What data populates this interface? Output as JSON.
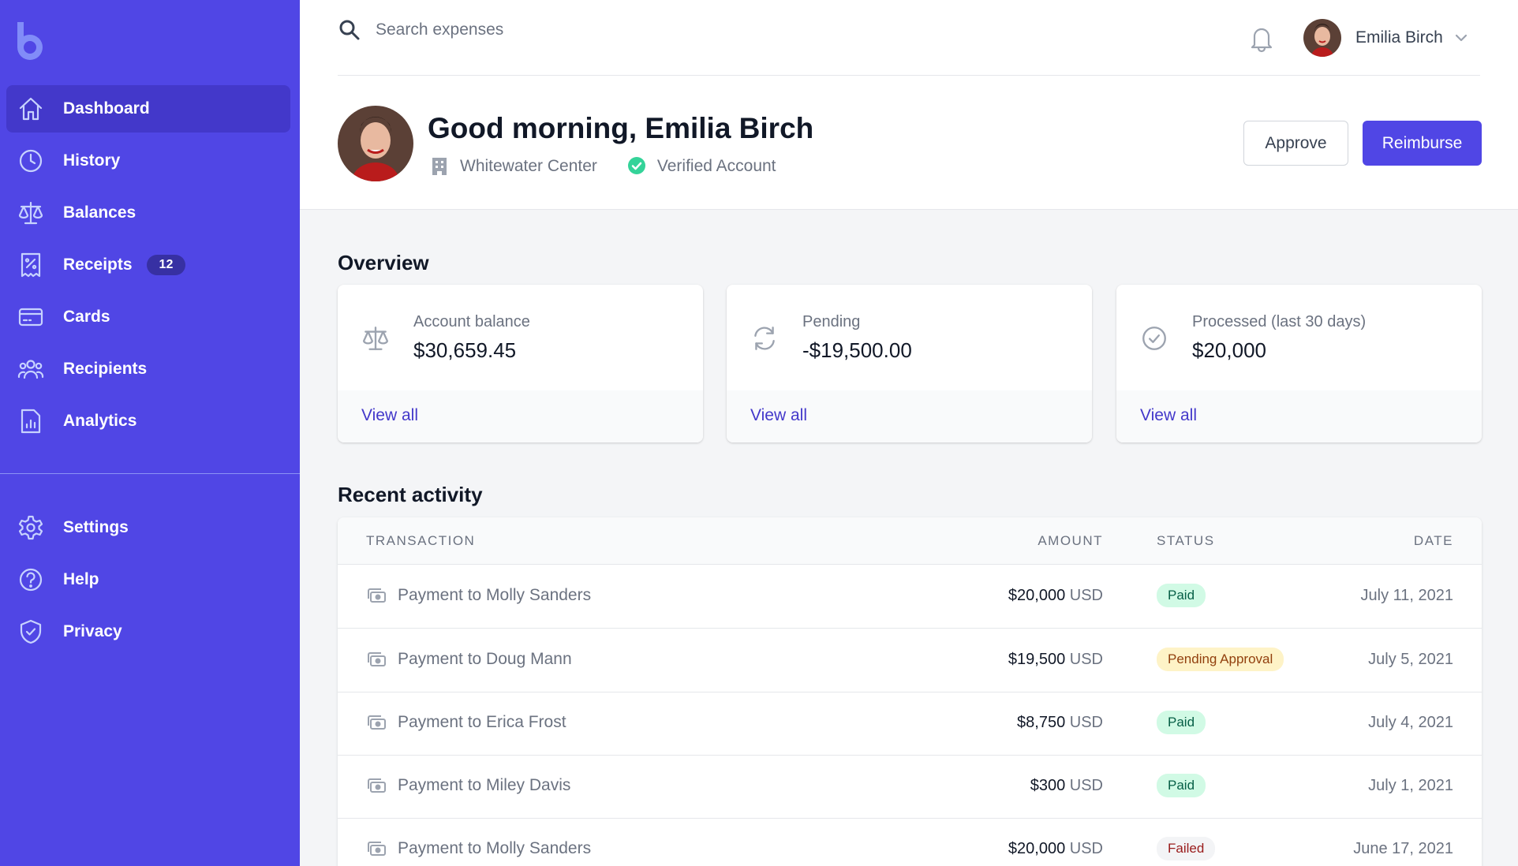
{
  "sidebar": {
    "nav": [
      {
        "label": "Dashboard",
        "icon": "home-icon"
      },
      {
        "label": "History",
        "icon": "clock-icon"
      },
      {
        "label": "Balances",
        "icon": "scale-icon"
      },
      {
        "label": "Receipts",
        "icon": "receipt-icon",
        "badge": "12"
      },
      {
        "label": "Cards",
        "icon": "credit-card-icon"
      },
      {
        "label": "Recipients",
        "icon": "users-icon"
      },
      {
        "label": "Analytics",
        "icon": "chart-icon"
      }
    ],
    "secondary": [
      {
        "label": "Settings",
        "icon": "gear-icon"
      },
      {
        "label": "Help",
        "icon": "question-icon"
      },
      {
        "label": "Privacy",
        "icon": "shield-icon"
      }
    ],
    "active": "Dashboard"
  },
  "search": {
    "placeholder": "Search expenses",
    "value": ""
  },
  "user": {
    "name": "Emilia Birch"
  },
  "header": {
    "greeting": "Good morning, Emilia Birch",
    "location": "Whitewater Center",
    "verified": "Verified Account",
    "approve_label": "Approve",
    "reimburse_label": "Reimburse"
  },
  "overview": {
    "title": "Overview",
    "cards": [
      {
        "label": "Account balance",
        "value": "$30,659.45",
        "link": "View all",
        "icon": "scale-icon"
      },
      {
        "label": "Pending",
        "value": "-$19,500.00",
        "link": "View all",
        "icon": "refresh-icon"
      },
      {
        "label": "Processed (last 30 days)",
        "value": "$20,000",
        "link": "View all",
        "icon": "check-circle-icon"
      }
    ]
  },
  "activity": {
    "title": "Recent activity",
    "columns": {
      "transaction": "TRANSACTION",
      "amount": "AMOUNT",
      "status": "STATUS",
      "date": "DATE"
    },
    "rows": [
      {
        "name": "Payment to Molly Sanders",
        "amount": "$20,000",
        "currency": "USD",
        "status": "Paid",
        "date": "July 11, 2021"
      },
      {
        "name": "Payment to Doug Mann",
        "amount": "$19,500",
        "currency": "USD",
        "status": "Pending Approval",
        "date": "July 5, 2021"
      },
      {
        "name": "Payment to Erica Frost",
        "amount": "$8,750",
        "currency": "USD",
        "status": "Paid",
        "date": "July 4, 2021"
      },
      {
        "name": "Payment to Miley Davis",
        "amount": "$300",
        "currency": "USD",
        "status": "Paid",
        "date": "July 1, 2021"
      },
      {
        "name": "Payment to Molly Sanders",
        "amount": "$20,000",
        "currency": "USD",
        "status": "Failed",
        "date": "June 17, 2021"
      }
    ]
  },
  "colors": {
    "brand": "#5046e5",
    "brand_dark": "#4338ca",
    "paid": "#d1fae5",
    "pending": "#fef3c7",
    "failed": "#f3f4f6"
  }
}
